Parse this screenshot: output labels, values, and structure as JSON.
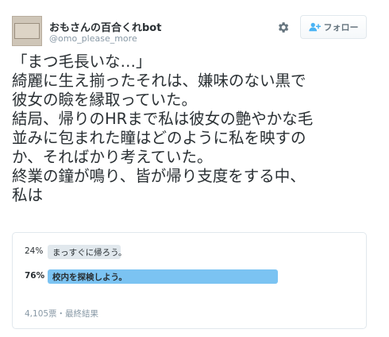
{
  "author": {
    "name": "おもさんの百合くれbot",
    "handle": "@omo_please_more"
  },
  "header": {
    "settings_icon": "gear-icon",
    "follow_label": "フォロー",
    "follow_icon": "follow-user-icon"
  },
  "tweet": {
    "lines": [
      "「まつ毛長いな…」",
      "綺麗に生え揃ったそれは、嫌味のない黒で",
      "彼女の瞼を縁取っていた。",
      "結局、帰りのHRまで私は彼女の艶やかな毛",
      "並みに包まれた瞳はどのように私を映すの",
      "か、そればかり考えていた。",
      "終業の鐘が鳴り、皆が帰り支度をする中、",
      "私は"
    ]
  },
  "poll": {
    "choices": [
      {
        "percent_text": "24%",
        "percent": 24,
        "label": "まっすぐに帰ろう。",
        "winner": false
      },
      {
        "percent_text": "76%",
        "percent": 76,
        "label": "校内を探検しよう。",
        "winner": true
      }
    ],
    "footer": "4,105票・最終結果"
  },
  "colors": {
    "winner_bar": "#7bc3f2",
    "loser_bar": "#e1e8ed",
    "text": "#292f33",
    "muted": "#8899a6",
    "border": "#e1e8ed"
  }
}
